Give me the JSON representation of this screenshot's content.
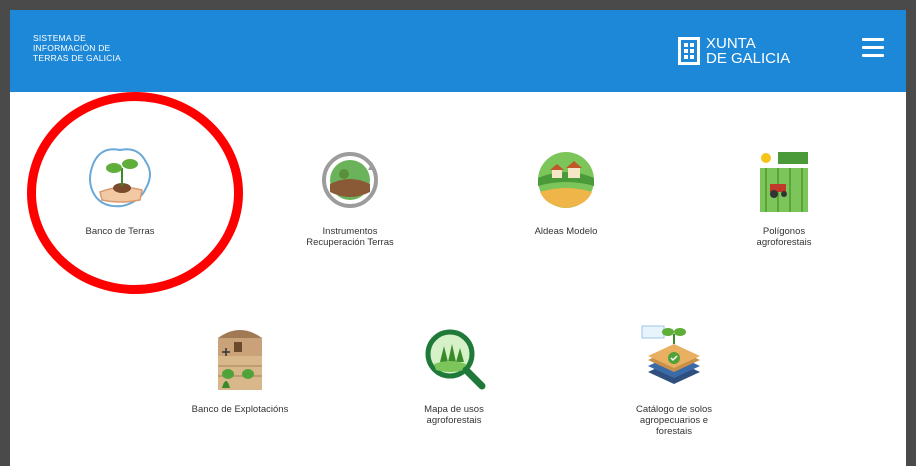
{
  "header": {
    "system_title_lines": [
      "SISTEMA DE",
      "INFORMACIÓN DE",
      "TERRAS DE GALICIA"
    ],
    "brand_line1": "XUNTA",
    "brand_line2": "DE GALICIA"
  },
  "tiles": [
    {
      "label": "Banco de Terras"
    },
    {
      "label": "Instrumentos Recuperación Terras"
    },
    {
      "label": "Aldeas Modelo"
    },
    {
      "label": "Polígonos agroforestais"
    },
    {
      "label": "Banco de Explotacións"
    },
    {
      "label": "Mapa de usos agroforestais"
    },
    {
      "label": "Catálogo de solos agropecuarios e forestais"
    }
  ],
  "colors": {
    "header_bg": "#1e88d8",
    "highlight": "#ff0000"
  }
}
